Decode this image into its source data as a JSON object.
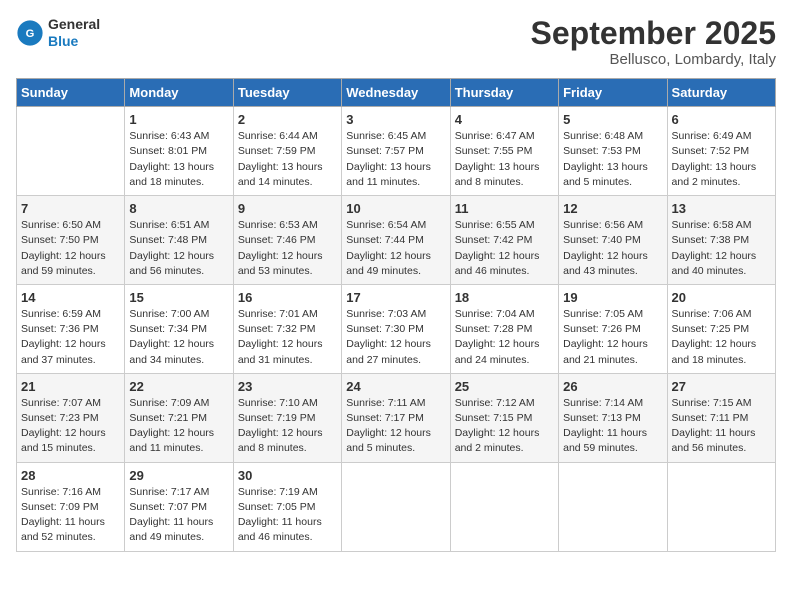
{
  "header": {
    "logo_line1": "General",
    "logo_line2": "Blue",
    "month_title": "September 2025",
    "location": "Bellusco, Lombardy, Italy"
  },
  "days_of_week": [
    "Sunday",
    "Monday",
    "Tuesday",
    "Wednesday",
    "Thursday",
    "Friday",
    "Saturday"
  ],
  "weeks": [
    [
      {
        "day": "",
        "info": ""
      },
      {
        "day": "1",
        "info": "Sunrise: 6:43 AM\nSunset: 8:01 PM\nDaylight: 13 hours\nand 18 minutes."
      },
      {
        "day": "2",
        "info": "Sunrise: 6:44 AM\nSunset: 7:59 PM\nDaylight: 13 hours\nand 14 minutes."
      },
      {
        "day": "3",
        "info": "Sunrise: 6:45 AM\nSunset: 7:57 PM\nDaylight: 13 hours\nand 11 minutes."
      },
      {
        "day": "4",
        "info": "Sunrise: 6:47 AM\nSunset: 7:55 PM\nDaylight: 13 hours\nand 8 minutes."
      },
      {
        "day": "5",
        "info": "Sunrise: 6:48 AM\nSunset: 7:53 PM\nDaylight: 13 hours\nand 5 minutes."
      },
      {
        "day": "6",
        "info": "Sunrise: 6:49 AM\nSunset: 7:52 PM\nDaylight: 13 hours\nand 2 minutes."
      }
    ],
    [
      {
        "day": "7",
        "info": "Sunrise: 6:50 AM\nSunset: 7:50 PM\nDaylight: 12 hours\nand 59 minutes."
      },
      {
        "day": "8",
        "info": "Sunrise: 6:51 AM\nSunset: 7:48 PM\nDaylight: 12 hours\nand 56 minutes."
      },
      {
        "day": "9",
        "info": "Sunrise: 6:53 AM\nSunset: 7:46 PM\nDaylight: 12 hours\nand 53 minutes."
      },
      {
        "day": "10",
        "info": "Sunrise: 6:54 AM\nSunset: 7:44 PM\nDaylight: 12 hours\nand 49 minutes."
      },
      {
        "day": "11",
        "info": "Sunrise: 6:55 AM\nSunset: 7:42 PM\nDaylight: 12 hours\nand 46 minutes."
      },
      {
        "day": "12",
        "info": "Sunrise: 6:56 AM\nSunset: 7:40 PM\nDaylight: 12 hours\nand 43 minutes."
      },
      {
        "day": "13",
        "info": "Sunrise: 6:58 AM\nSunset: 7:38 PM\nDaylight: 12 hours\nand 40 minutes."
      }
    ],
    [
      {
        "day": "14",
        "info": "Sunrise: 6:59 AM\nSunset: 7:36 PM\nDaylight: 12 hours\nand 37 minutes."
      },
      {
        "day": "15",
        "info": "Sunrise: 7:00 AM\nSunset: 7:34 PM\nDaylight: 12 hours\nand 34 minutes."
      },
      {
        "day": "16",
        "info": "Sunrise: 7:01 AM\nSunset: 7:32 PM\nDaylight: 12 hours\nand 31 minutes."
      },
      {
        "day": "17",
        "info": "Sunrise: 7:03 AM\nSunset: 7:30 PM\nDaylight: 12 hours\nand 27 minutes."
      },
      {
        "day": "18",
        "info": "Sunrise: 7:04 AM\nSunset: 7:28 PM\nDaylight: 12 hours\nand 24 minutes."
      },
      {
        "day": "19",
        "info": "Sunrise: 7:05 AM\nSunset: 7:26 PM\nDaylight: 12 hours\nand 21 minutes."
      },
      {
        "day": "20",
        "info": "Sunrise: 7:06 AM\nSunset: 7:25 PM\nDaylight: 12 hours\nand 18 minutes."
      }
    ],
    [
      {
        "day": "21",
        "info": "Sunrise: 7:07 AM\nSunset: 7:23 PM\nDaylight: 12 hours\nand 15 minutes."
      },
      {
        "day": "22",
        "info": "Sunrise: 7:09 AM\nSunset: 7:21 PM\nDaylight: 12 hours\nand 11 minutes."
      },
      {
        "day": "23",
        "info": "Sunrise: 7:10 AM\nSunset: 7:19 PM\nDaylight: 12 hours\nand 8 minutes."
      },
      {
        "day": "24",
        "info": "Sunrise: 7:11 AM\nSunset: 7:17 PM\nDaylight: 12 hours\nand 5 minutes."
      },
      {
        "day": "25",
        "info": "Sunrise: 7:12 AM\nSunset: 7:15 PM\nDaylight: 12 hours\nand 2 minutes."
      },
      {
        "day": "26",
        "info": "Sunrise: 7:14 AM\nSunset: 7:13 PM\nDaylight: 11 hours\nand 59 minutes."
      },
      {
        "day": "27",
        "info": "Sunrise: 7:15 AM\nSunset: 7:11 PM\nDaylight: 11 hours\nand 56 minutes."
      }
    ],
    [
      {
        "day": "28",
        "info": "Sunrise: 7:16 AM\nSunset: 7:09 PM\nDaylight: 11 hours\nand 52 minutes."
      },
      {
        "day": "29",
        "info": "Sunrise: 7:17 AM\nSunset: 7:07 PM\nDaylight: 11 hours\nand 49 minutes."
      },
      {
        "day": "30",
        "info": "Sunrise: 7:19 AM\nSunset: 7:05 PM\nDaylight: 11 hours\nand 46 minutes."
      },
      {
        "day": "",
        "info": ""
      },
      {
        "day": "",
        "info": ""
      },
      {
        "day": "",
        "info": ""
      },
      {
        "day": "",
        "info": ""
      }
    ]
  ]
}
